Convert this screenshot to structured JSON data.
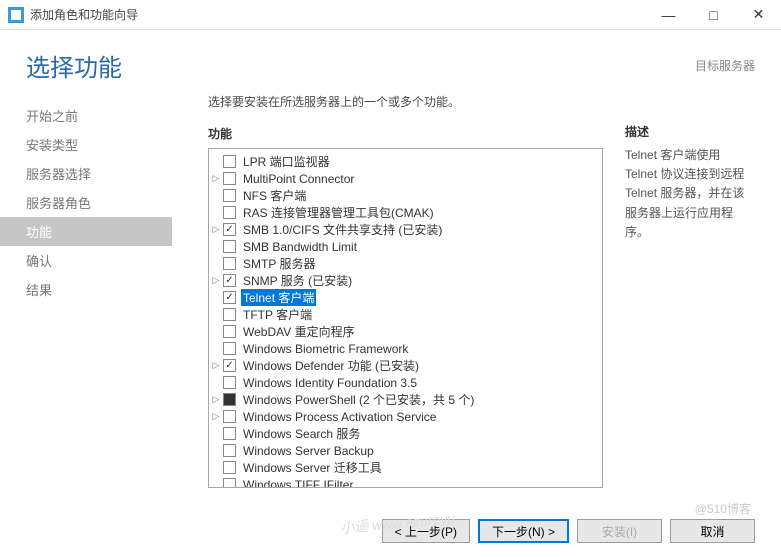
{
  "window": {
    "title": "添加角色和功能向导",
    "min": "—",
    "max": "□",
    "close": "✕"
  },
  "header": {
    "title": "选择功能",
    "target": "目标服务器"
  },
  "sidebar": {
    "items": [
      {
        "label": "开始之前"
      },
      {
        "label": "安装类型"
      },
      {
        "label": "服务器选择"
      },
      {
        "label": "服务器角色"
      },
      {
        "label": "功能"
      },
      {
        "label": "确认"
      },
      {
        "label": "结果"
      }
    ],
    "active_index": 4
  },
  "main": {
    "intro": "选择要安装在所选服务器上的一个或多个功能。",
    "features_label": "功能",
    "description_label": "描述",
    "description_text": "Telnet 客户端使用 Telnet 协议连接到远程 Telnet 服务器，并在该服务器上运行应用程序。"
  },
  "features": [
    {
      "expand": "",
      "state": "unchecked",
      "label": "LPR 端口监视器",
      "selected": false
    },
    {
      "expand": "▷",
      "state": "unchecked",
      "label": "MultiPoint Connector",
      "selected": false
    },
    {
      "expand": "",
      "state": "unchecked",
      "label": "NFS 客户端",
      "selected": false
    },
    {
      "expand": "",
      "state": "unchecked",
      "label": "RAS 连接管理器管理工具包(CMAK)",
      "selected": false
    },
    {
      "expand": "▷",
      "state": "checked",
      "label": "SMB 1.0/CIFS 文件共享支持 (已安装)",
      "selected": false
    },
    {
      "expand": "",
      "state": "unchecked",
      "label": "SMB Bandwidth Limit",
      "selected": false
    },
    {
      "expand": "",
      "state": "unchecked",
      "label": "SMTP 服务器",
      "selected": false
    },
    {
      "expand": "▷",
      "state": "checked",
      "label": "SNMP 服务 (已安装)",
      "selected": false
    },
    {
      "expand": "",
      "state": "checked",
      "label": "Telnet 客户端",
      "selected": true
    },
    {
      "expand": "",
      "state": "unchecked",
      "label": "TFTP 客户端",
      "selected": false
    },
    {
      "expand": "",
      "state": "unchecked",
      "label": "WebDAV 重定向程序",
      "selected": false
    },
    {
      "expand": "",
      "state": "unchecked",
      "label": "Windows Biometric Framework",
      "selected": false
    },
    {
      "expand": "▷",
      "state": "checked",
      "label": "Windows Defender 功能 (已安装)",
      "selected": false
    },
    {
      "expand": "",
      "state": "unchecked",
      "label": "Windows Identity Foundation 3.5",
      "selected": false
    },
    {
      "expand": "▷",
      "state": "filled",
      "label": "Windows PowerShell (2 个已安装，共 5 个)",
      "selected": false
    },
    {
      "expand": "▷",
      "state": "unchecked",
      "label": "Windows Process Activation Service",
      "selected": false
    },
    {
      "expand": "",
      "state": "unchecked",
      "label": "Windows Search 服务",
      "selected": false
    },
    {
      "expand": "",
      "state": "unchecked",
      "label": "Windows Server Backup",
      "selected": false
    },
    {
      "expand": "",
      "state": "unchecked",
      "label": "Windows Server 迁移工具",
      "selected": false
    },
    {
      "expand": "",
      "state": "unchecked",
      "label": "Windows TIFF IFilter",
      "selected": false
    }
  ],
  "footer": {
    "prev": "< 上一步(P)",
    "next": "下一步(N) >",
    "install": "安装(I)",
    "cancel": "取消"
  },
  "watermark": {
    "a": "@510博客",
    "b": "小遥\nwww.azureyu"
  }
}
